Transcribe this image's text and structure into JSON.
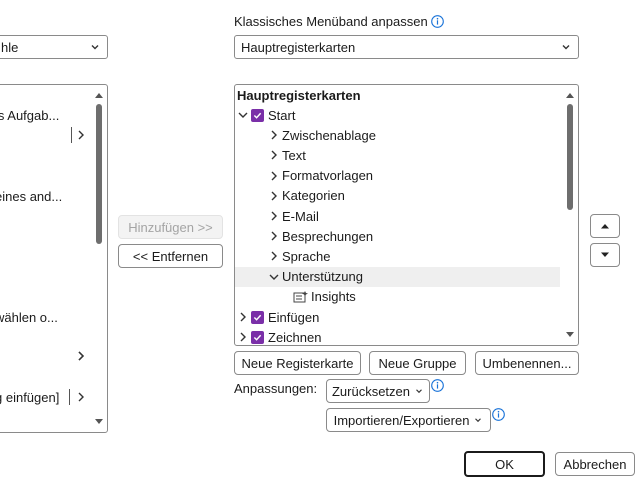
{
  "left_panel": {
    "combo_value": "hle",
    "items": [
      "ls Aufgab...",
      "eines and...",
      "wählen o...",
      "g einfügen]"
    ]
  },
  "center": {
    "add_button": "Hinzufügen >>",
    "remove_button": "<< Entfernen"
  },
  "right_panel": {
    "title": "Klassisches Menüband anpassen",
    "combo_value": "Hauptregisterkarten",
    "tree_header": "Hauptregisterkarten",
    "tree": [
      {
        "label": "Start",
        "level": 0,
        "expanded": true,
        "checked": true
      },
      {
        "label": "Zwischenablage",
        "level": 1,
        "expanded": false
      },
      {
        "label": "Text",
        "level": 1,
        "expanded": false
      },
      {
        "label": "Formatvorlagen",
        "level": 1,
        "expanded": false
      },
      {
        "label": "Kategorien",
        "level": 1,
        "expanded": false
      },
      {
        "label": "E-Mail",
        "level": 1,
        "expanded": false
      },
      {
        "label": "Besprechungen",
        "level": 1,
        "expanded": false
      },
      {
        "label": "Sprache",
        "level": 1,
        "expanded": false
      },
      {
        "label": "Unterstützung",
        "level": 1,
        "expanded": true,
        "selected": true
      },
      {
        "label": "Insights",
        "level": 2,
        "icon": "add-in-icon"
      },
      {
        "label": "Einfügen",
        "level": 0,
        "expanded": false,
        "checked": true
      },
      {
        "label": "Zeichnen",
        "level": 0,
        "expanded": false,
        "checked": true
      }
    ],
    "new_tab_button": "Neue Registerkarte",
    "new_group_button": "Neue Gruppe",
    "rename_button": "Umbenennen...",
    "customizations_label": "Anpassungen:",
    "reset_button": "Zurücksetzen",
    "import_export_button": "Importieren/Exportieren"
  },
  "footer": {
    "ok_button": "OK",
    "cancel_button": "Abbrechen"
  },
  "colors": {
    "checkbox": "#7a2fa8",
    "info": "#1a73d8"
  }
}
